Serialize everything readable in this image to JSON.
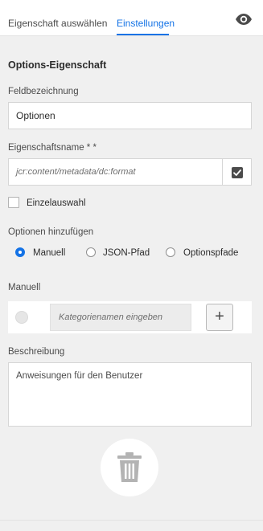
{
  "tabs": [
    {
      "label": "Eigenschaft auswählen",
      "active": false
    },
    {
      "label": "Einstellungen",
      "active": true
    }
  ],
  "header": {
    "preview_icon": "eye-icon"
  },
  "section": {
    "title": "Options-Eigenschaft"
  },
  "field_label": {
    "label": "Feldbezeichnung",
    "value": "Optionen"
  },
  "property_name": {
    "label": "Eigenschaftsname * *",
    "value": "jcr:content/metadata/dc:format",
    "icon": "checkbox-checked-icon"
  },
  "single_select": {
    "label": "Einzelauswahl",
    "checked": false
  },
  "add_options": {
    "label": "Optionen hinzufügen",
    "options": [
      {
        "label": "Manuell",
        "checked": true
      },
      {
        "label": "JSON-Pfad",
        "checked": false
      },
      {
        "label": "Optionspfade",
        "checked": false
      }
    ]
  },
  "manual": {
    "label": "Manuell",
    "placeholder": "Kategorienamen eingeben",
    "add_label": "+"
  },
  "description": {
    "label": "Beschreibung",
    "placeholder": "Anweisungen für den Benutzer"
  },
  "delete": {
    "icon": "trash-icon"
  },
  "colors": {
    "accent": "#1473e6",
    "background": "#f0f0f0",
    "panel": "#ffffff"
  }
}
